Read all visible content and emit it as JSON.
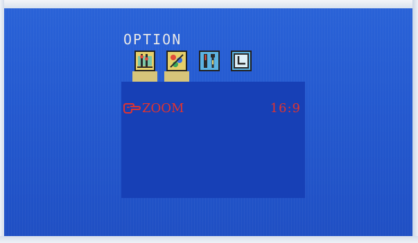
{
  "menu": {
    "title": "OPTION",
    "tabs": [
      {
        "icon": "picture-settings-icon",
        "active": true
      },
      {
        "icon": "color-settings-icon",
        "active": true
      },
      {
        "icon": "tools-icon",
        "active": false
      },
      {
        "icon": "clock-icon",
        "active": false
      }
    ]
  },
  "settings": {
    "zoom": {
      "label": "ZOOM",
      "value": "16:9",
      "icon": "pointing-hand-icon"
    }
  },
  "colors": {
    "background": "#2459cf",
    "panel": "#1740b6",
    "highlight_text": "#e2332f",
    "title_text": "#e8e8e8"
  }
}
